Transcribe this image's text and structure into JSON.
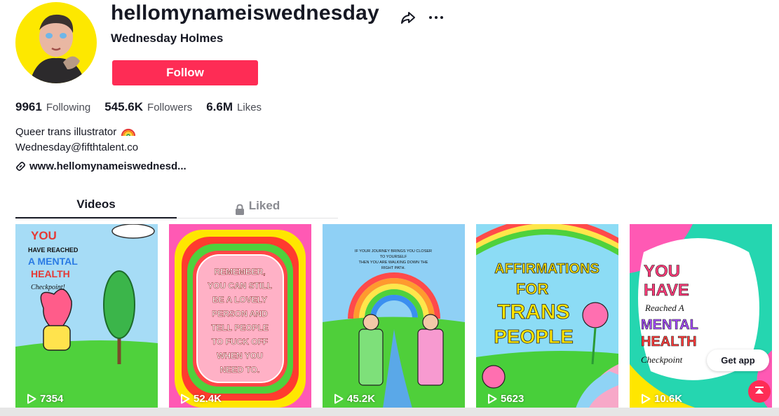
{
  "profile": {
    "username": "hellomynameiswednesday",
    "display_name": "Wednesday Holmes",
    "follow_label": "Follow"
  },
  "stats": [
    {
      "value": "9961",
      "label": "Following"
    },
    {
      "value": "545.6K",
      "label": "Followers"
    },
    {
      "value": "6.6M",
      "label": "Likes"
    }
  ],
  "bio": {
    "line1": "Queer trans illustrator",
    "line2": "Wednesday@fifthtalent.co",
    "link": "www.hellomynameiswednesd..."
  },
  "tabs": {
    "videos": "Videos",
    "liked": "Liked"
  },
  "videos": [
    {
      "views": "7354",
      "art_text": [
        "YOU",
        "HAVE REACHED",
        "A MENTAL",
        "HEALTH",
        "Checkpoint!"
      ]
    },
    {
      "views": "52.4K",
      "art_text": [
        "REMEMBER,",
        "YOU CAN STILL",
        "BE A LOVELY",
        "PERSON AND",
        "TELL PEOPLE",
        "TO FUCK OFF",
        "WHEN YOU",
        "NEED TO."
      ]
    },
    {
      "views": "45.2K",
      "art_text": [
        "IF YOUR JOURNEY BRINGS YOU CLOSER",
        "TO YOURSELF",
        "THEN YOU ARE WALKING DOWN THE",
        "RIGHT PATH."
      ]
    },
    {
      "views": "5623",
      "art_text": [
        "AFFIRMATIONS",
        "FOR",
        "TRANS",
        "PEOPLE"
      ]
    },
    {
      "views": "10.6K",
      "art_text": [
        "YOU",
        "HAVE",
        "Reached A",
        "MENTAL",
        "HEALTH",
        "Checkpoint"
      ]
    }
  ],
  "overlay": {
    "get_app": "Get app"
  },
  "colors": {
    "accent": "#fe2c55",
    "text": "#161823",
    "muted": "#8a8b91"
  }
}
